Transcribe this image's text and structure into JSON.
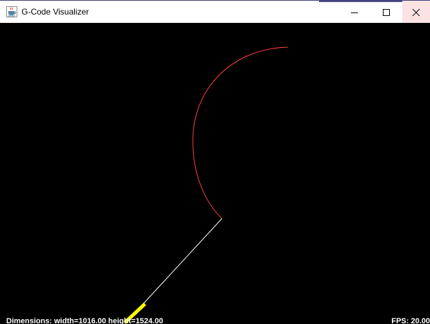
{
  "window": {
    "title": "G-Code Visualizer",
    "icon": "java-coffee-cup-icon",
    "controls": {
      "minimize_icon": "minimize-icon",
      "maximize_icon": "maximize-icon",
      "close_icon": "close-icon"
    }
  },
  "canvas": {
    "background_color": "#000000",
    "arc_color": "#ff4040",
    "line_color": "#ffffff",
    "tool_color": "#ffff00"
  },
  "status": {
    "dimensions_text": "Dimensions: width=1016.00 height=1524.00",
    "fps_text": "FPS: 20.00"
  }
}
